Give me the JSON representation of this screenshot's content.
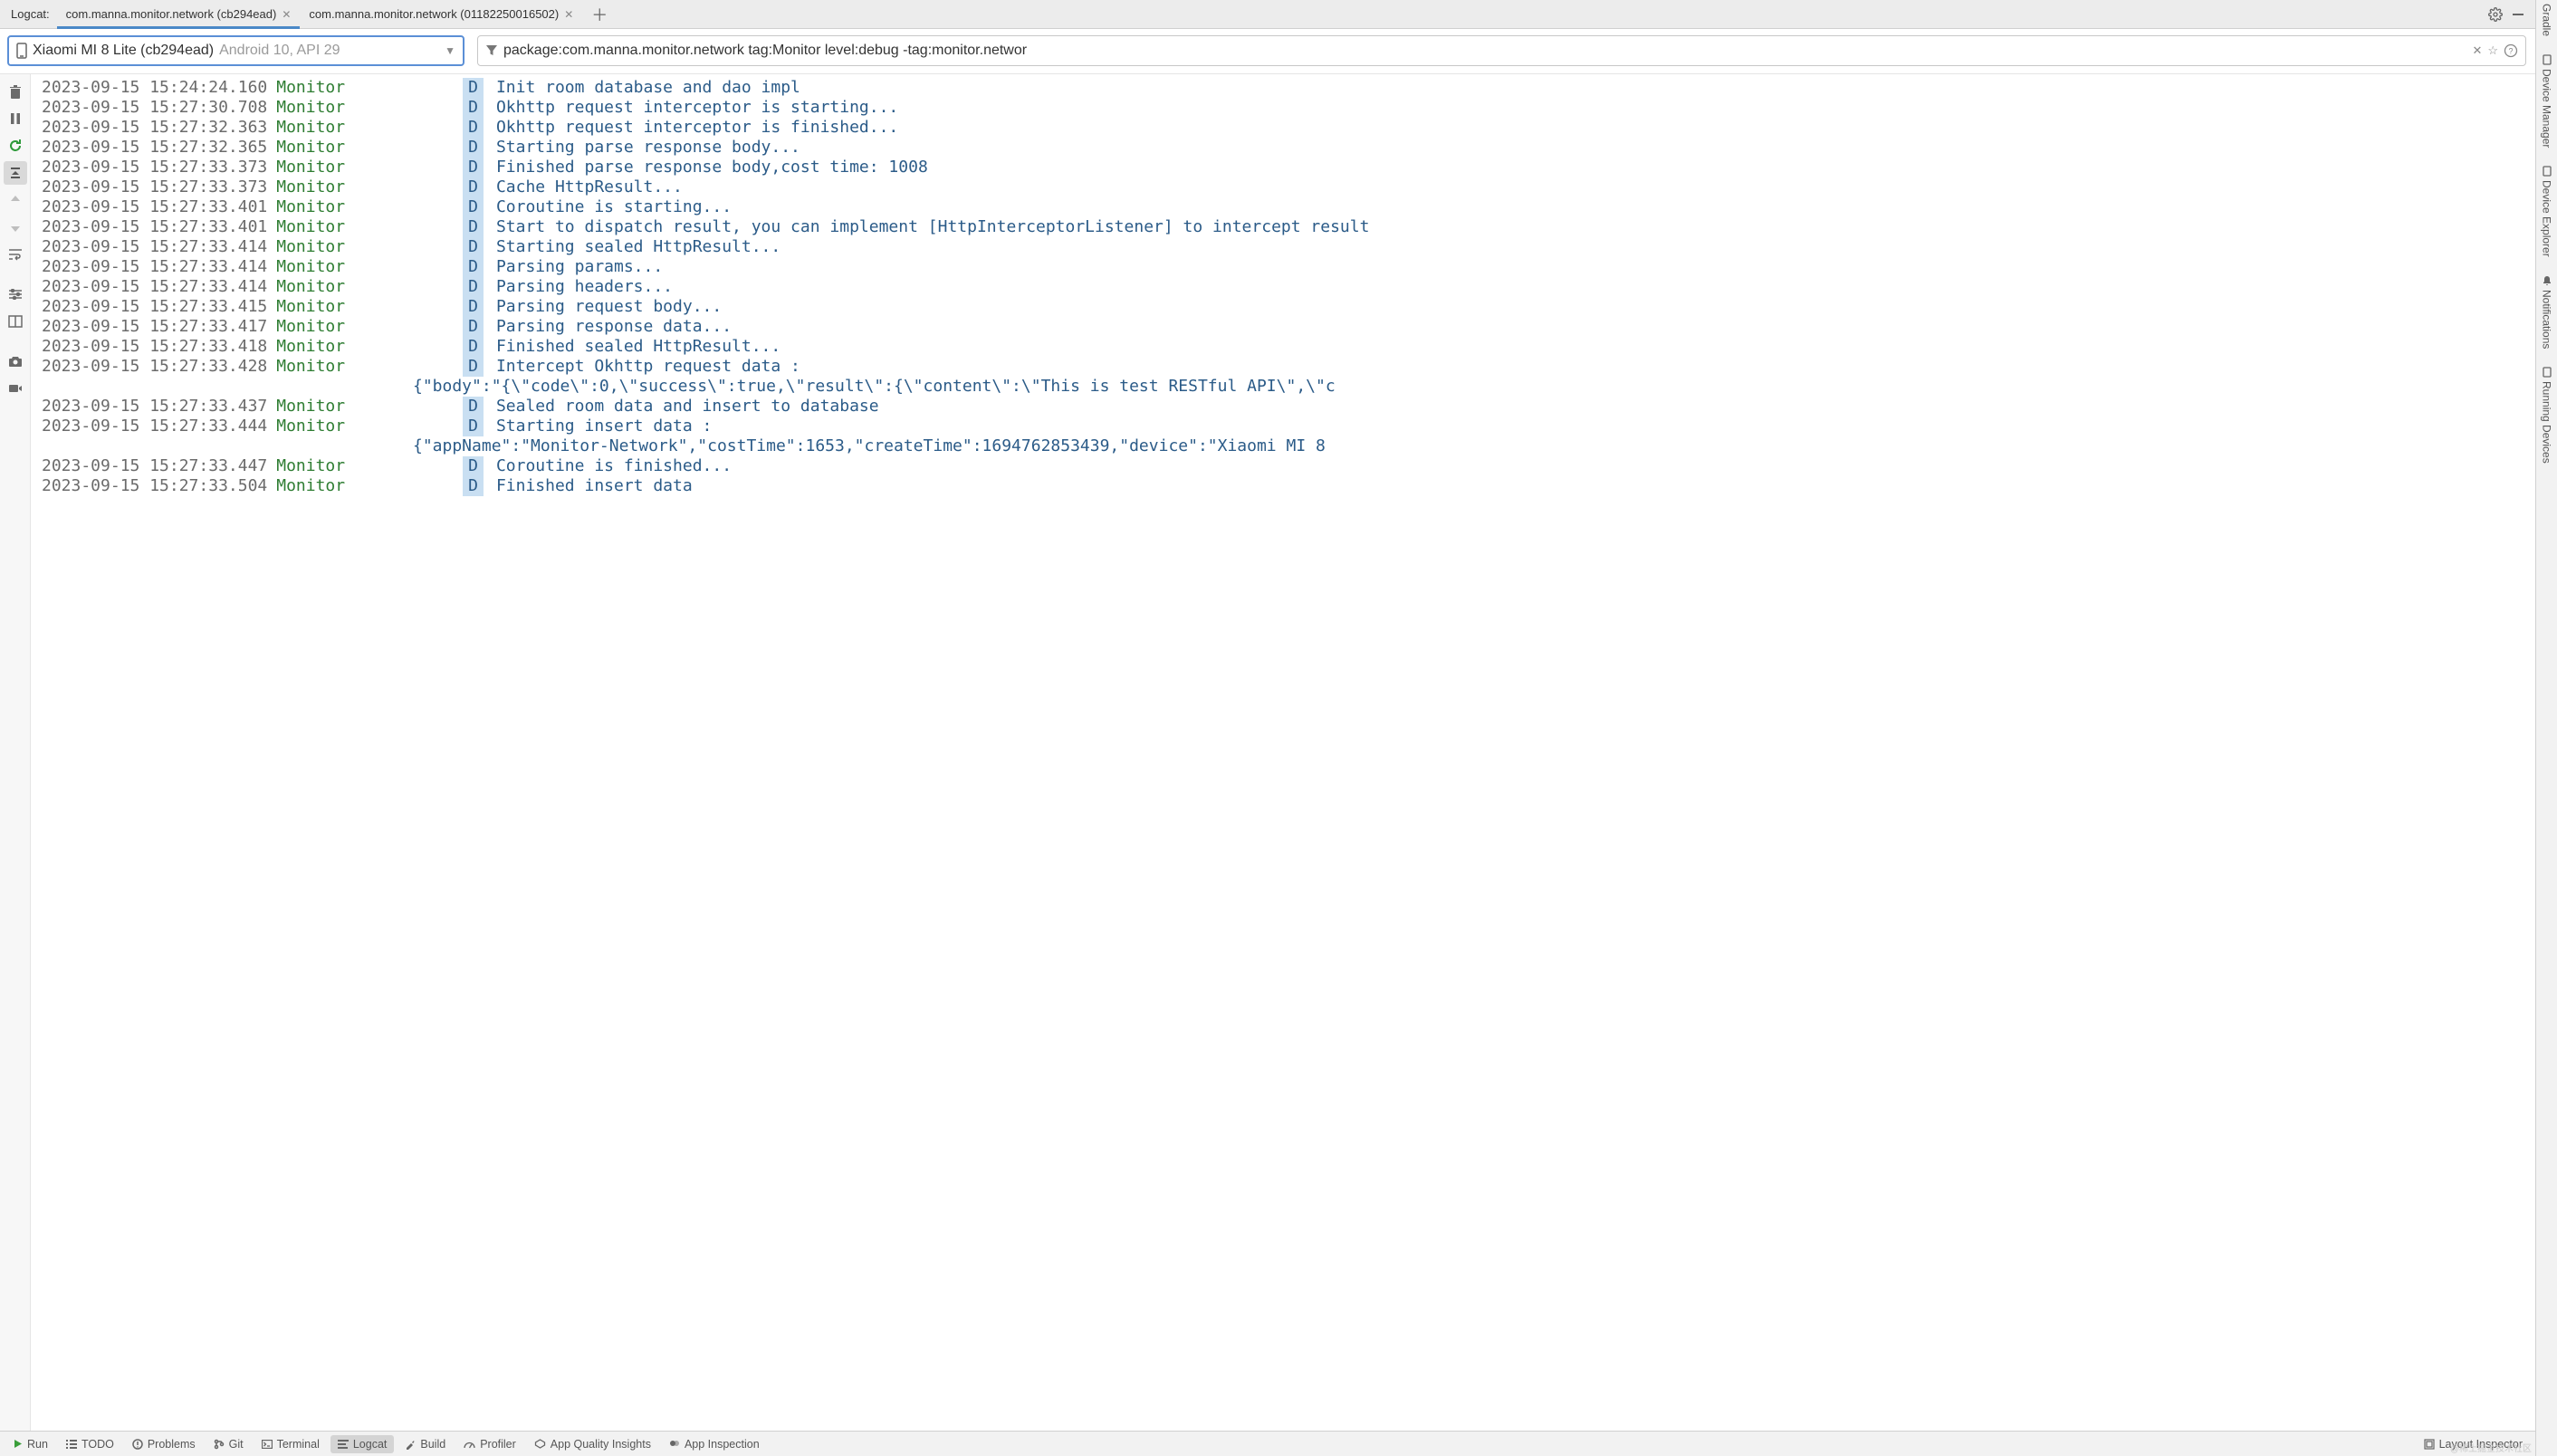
{
  "header": {
    "logcat_label": "Logcat:",
    "tabs": [
      {
        "label": "com.manna.monitor.network (cb294ead)",
        "active": true
      },
      {
        "label": "com.manna.monitor.network (01182250016502)",
        "active": false
      }
    ]
  },
  "device": {
    "name": "Xiaomi MI 8 Lite (cb294ead)",
    "api": "Android 10, API 29"
  },
  "filter": {
    "value": "package:com.manna.monitor.network tag:Monitor level:debug -tag:monitor.networ"
  },
  "logs": [
    {
      "ts": "2023-09-15 15:24:24.160",
      "tag": "Monitor",
      "lvl": "D",
      "msg": "Init room database and dao impl"
    },
    {
      "ts": "2023-09-15 15:27:30.708",
      "tag": "Monitor",
      "lvl": "D",
      "msg": "Okhttp request interceptor is starting..."
    },
    {
      "ts": "2023-09-15 15:27:32.363",
      "tag": "Monitor",
      "lvl": "D",
      "msg": "Okhttp request interceptor is finished..."
    },
    {
      "ts": "2023-09-15 15:27:32.365",
      "tag": "Monitor",
      "lvl": "D",
      "msg": "Starting parse response body..."
    },
    {
      "ts": "2023-09-15 15:27:33.373",
      "tag": "Monitor",
      "lvl": "D",
      "msg": "Finished parse response body,cost time: 1008"
    },
    {
      "ts": "2023-09-15 15:27:33.373",
      "tag": "Monitor",
      "lvl": "D",
      "msg": "Cache HttpResult..."
    },
    {
      "ts": "2023-09-15 15:27:33.401",
      "tag": "Monitor",
      "lvl": "D",
      "msg": "Coroutine is starting..."
    },
    {
      "ts": "2023-09-15 15:27:33.401",
      "tag": "Monitor",
      "lvl": "D",
      "msg": "Start to dispatch result, you can implement [HttpInterceptorListener] to intercept result"
    },
    {
      "ts": "2023-09-15 15:27:33.414",
      "tag": "Monitor",
      "lvl": "D",
      "msg": "Starting sealed HttpResult..."
    },
    {
      "ts": "2023-09-15 15:27:33.414",
      "tag": "Monitor",
      "lvl": "D",
      "msg": "Parsing params..."
    },
    {
      "ts": "2023-09-15 15:27:33.414",
      "tag": "Monitor",
      "lvl": "D",
      "msg": "Parsing headers..."
    },
    {
      "ts": "2023-09-15 15:27:33.415",
      "tag": "Monitor",
      "lvl": "D",
      "msg": "Parsing request body..."
    },
    {
      "ts": "2023-09-15 15:27:33.417",
      "tag": "Monitor",
      "lvl": "D",
      "msg": "Parsing response data..."
    },
    {
      "ts": "2023-09-15 15:27:33.418",
      "tag": "Monitor",
      "lvl": "D",
      "msg": "Finished sealed HttpResult..."
    },
    {
      "ts": "2023-09-15 15:27:33.428",
      "tag": "Monitor",
      "lvl": "D",
      "msg": "Intercept Okhttp request data :",
      "cont": "{\"body\":\"{\\\"code\\\":0,\\\"success\\\":true,\\\"result\\\":{\\\"content\\\":\\\"This is test RESTful API\\\",\\\"c"
    },
    {
      "ts": "2023-09-15 15:27:33.437",
      "tag": "Monitor",
      "lvl": "D",
      "msg": "Sealed room data and insert to database"
    },
    {
      "ts": "2023-09-15 15:27:33.444",
      "tag": "Monitor",
      "lvl": "D",
      "msg": "Starting insert data :",
      "cont": "{\"appName\":\"Monitor-Network\",\"costTime\":1653,\"createTime\":1694762853439,\"device\":\"Xiaomi MI 8"
    },
    {
      "ts": "2023-09-15 15:27:33.447",
      "tag": "Monitor",
      "lvl": "D",
      "msg": "Coroutine is finished..."
    },
    {
      "ts": "2023-09-15 15:27:33.504",
      "tag": "Monitor",
      "lvl": "D",
      "msg": "Finished insert data"
    }
  ],
  "bottom": {
    "run": "Run",
    "todo": "TODO",
    "problems": "Problems",
    "git": "Git",
    "terminal": "Terminal",
    "logcat": "Logcat",
    "build": "Build",
    "profiler": "Profiler",
    "aqi": "App Quality Insights",
    "inspection": "App Inspection",
    "layout": "Layout Inspector"
  },
  "right_rail": {
    "gradle": "Gradle",
    "device_manager": "Device Manager",
    "device_explorer": "Device Explorer",
    "notifications": "Notifications",
    "running_devices": "Running Devices"
  },
  "watermark": "@稀土掘金技术社区"
}
